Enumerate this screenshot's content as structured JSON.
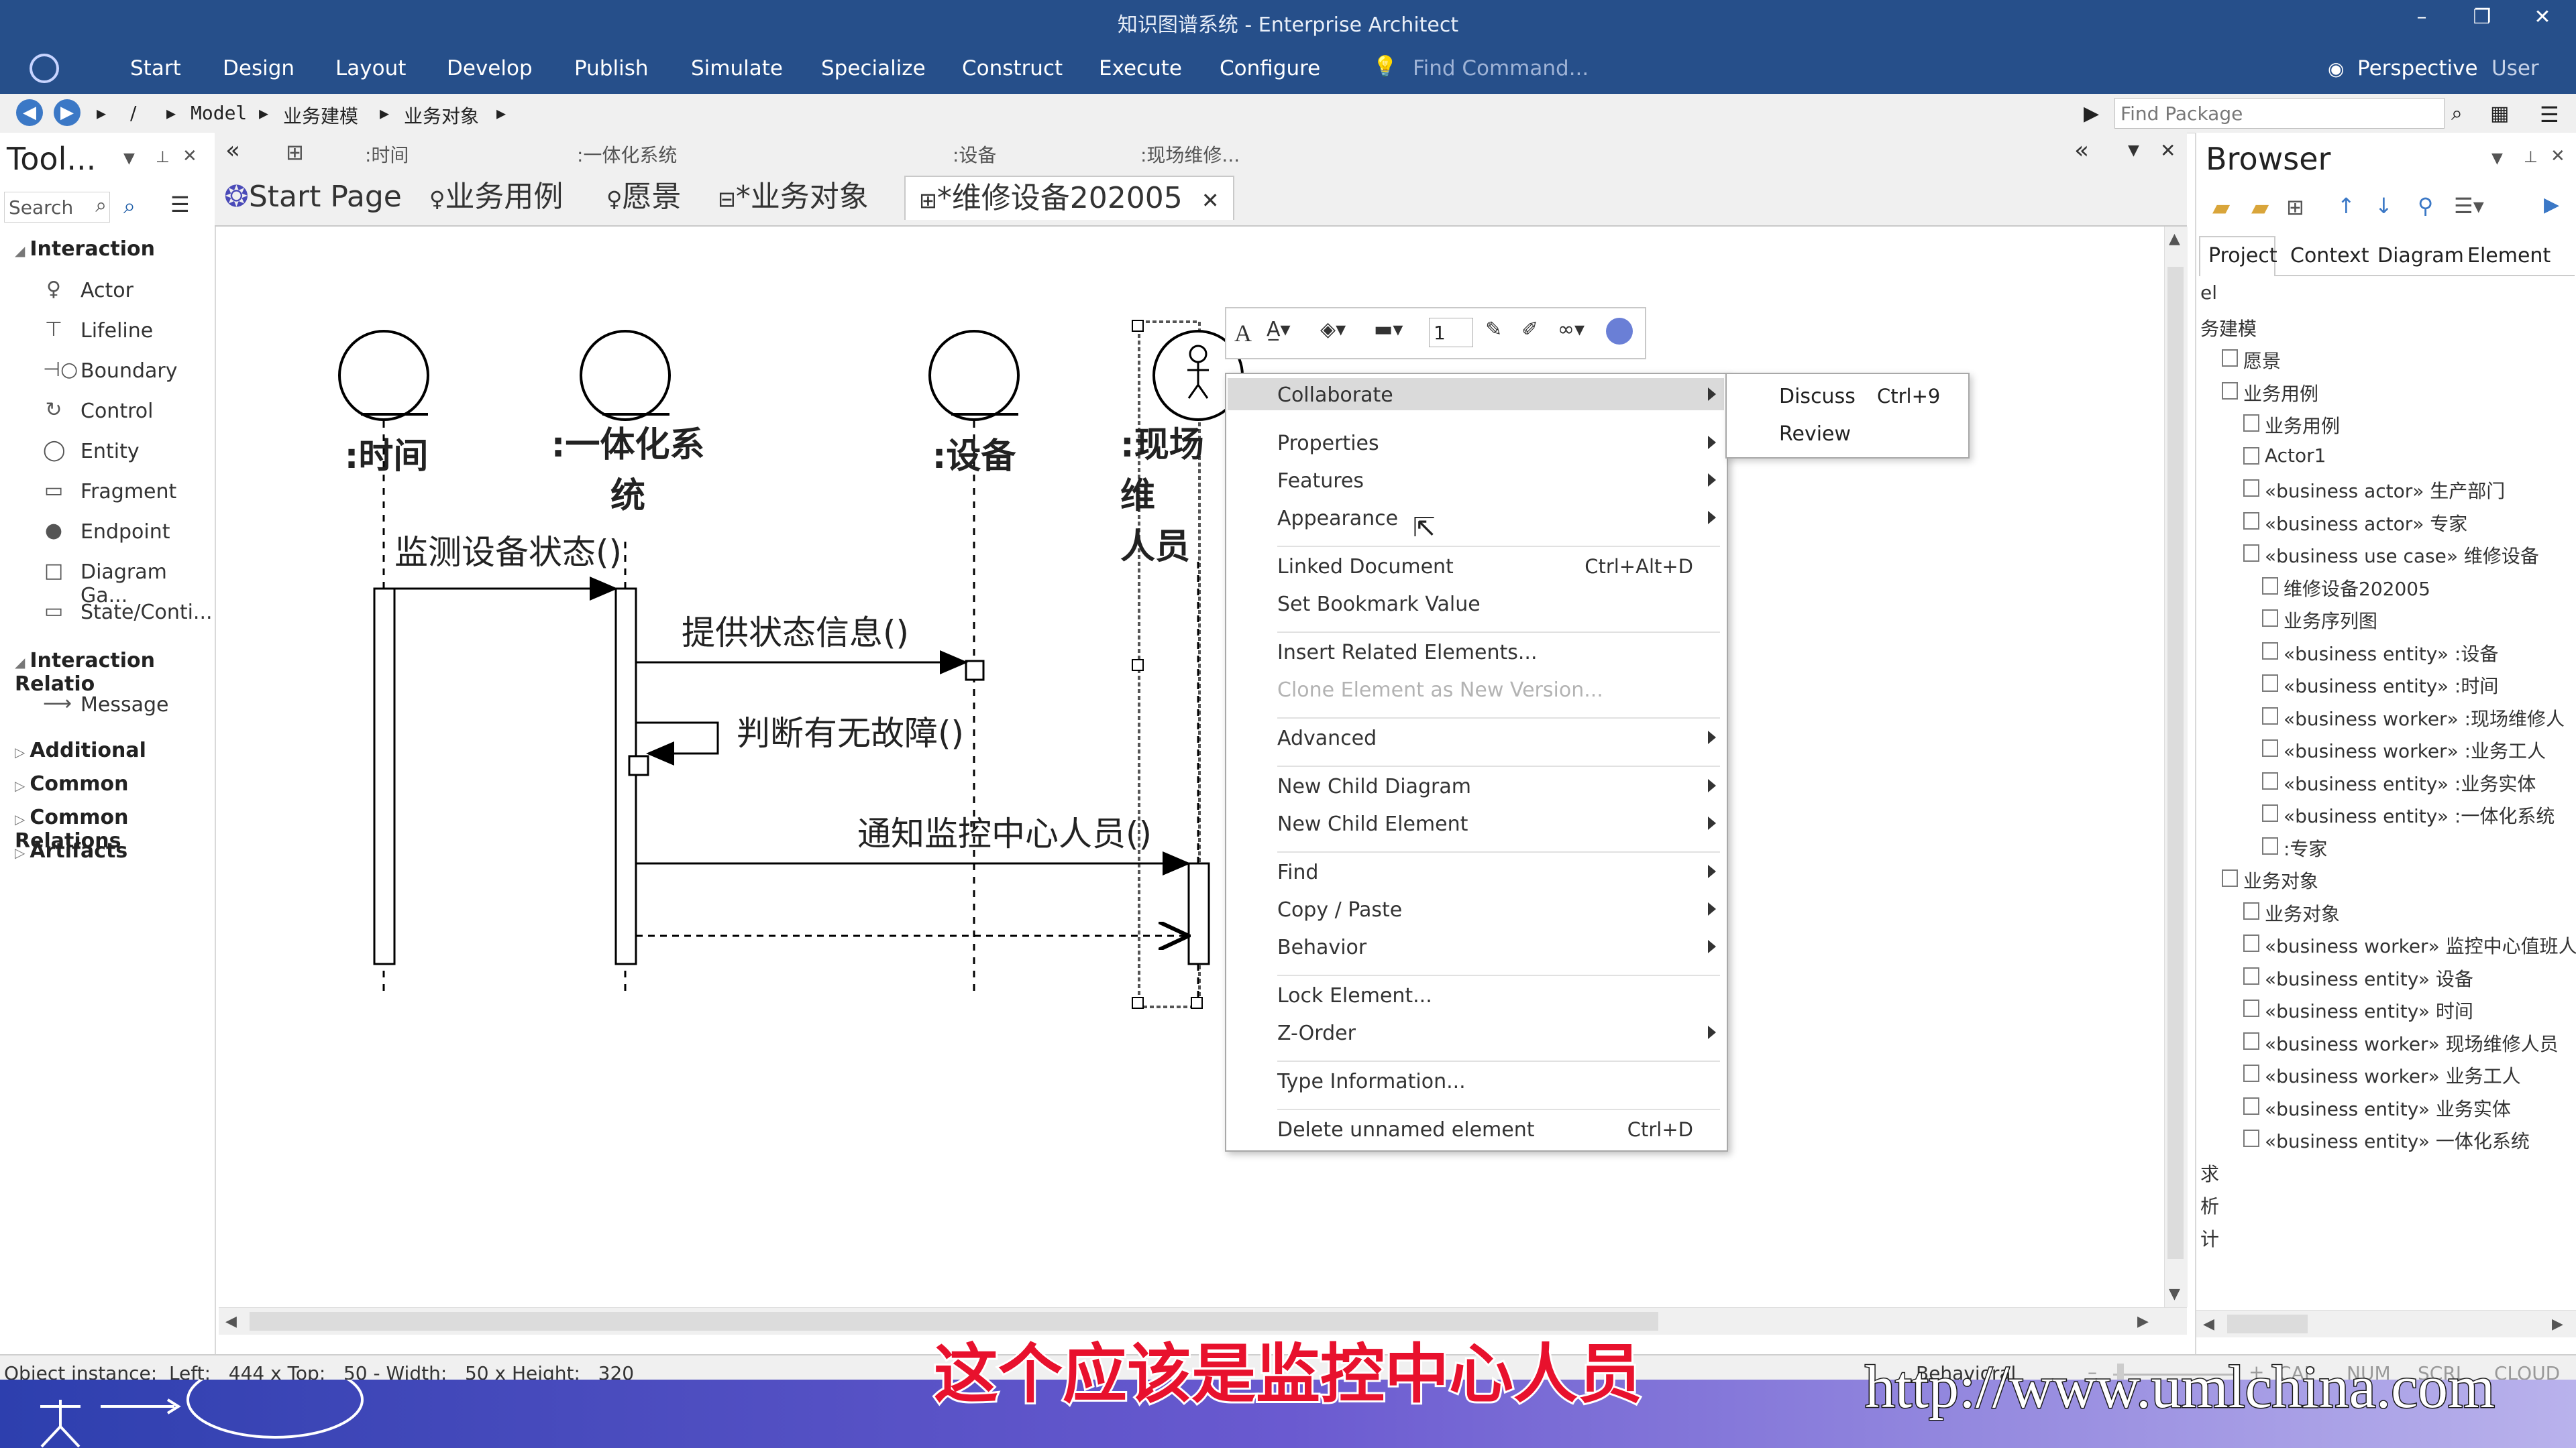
{
  "window": {
    "title": "知识图谱系统 - Enterprise Architect"
  },
  "menu": {
    "items": [
      "Start",
      "Design",
      "Layout",
      "Develop",
      "Publish",
      "Simulate",
      "Specialize",
      "Construct",
      "Execute",
      "Configure"
    ],
    "find_placeholder": "Find Command...",
    "perspective": "Perspective",
    "user": "User"
  },
  "nav": {
    "path": [
      "/",
      "Model",
      "业务建模",
      "业务对象"
    ],
    "find_package_placeholder": "Find Package"
  },
  "toolbox": {
    "title": "Tool...",
    "search_placeholder": "Search",
    "groups": [
      {
        "label": "Interaction",
        "items": [
          "Actor",
          "Lifeline",
          "Boundary",
          "Control",
          "Entity",
          "Fragment",
          "Endpoint",
          "Diagram Ga...",
          "State/Conti..."
        ]
      },
      {
        "label": "Interaction Relatio",
        "items": [
          "Message"
        ]
      },
      {
        "label": "Additional",
        "items": []
      },
      {
        "label": "Common",
        "items": []
      },
      {
        "label": "Common Relations",
        "items": []
      },
      {
        "label": "Artifacts",
        "items": []
      }
    ]
  },
  "docbar": {
    "labels": [
      ":时间",
      ":一体化系统",
      ":设备",
      ":现场维修..."
    ]
  },
  "tabs": [
    {
      "label": "Start Page"
    },
    {
      "label": "业务用例"
    },
    {
      "label": "愿景"
    },
    {
      "label": "*业务对象"
    },
    {
      "label": "*维修设备202005"
    }
  ],
  "diagram": {
    "lifelines": [
      ":时间",
      ":一体化系统",
      ":设备",
      ":现场维修人员"
    ],
    "lifeline_labels_shown": [
      ":时间",
      ":一体化系\n统",
      ":设备",
      ":现场维\n人员"
    ],
    "messages": [
      "监测设备状态()",
      "提供状态信息()",
      "判断有无故障()",
      "通知监控中心人员()"
    ]
  },
  "format_toolbar": {
    "line_width": "1"
  },
  "context_menu": {
    "items": [
      {
        "label": "Collaborate",
        "sub": true,
        "highlight": true
      },
      {
        "label": "Properties",
        "sub": true
      },
      {
        "label": "Features",
        "sub": true
      },
      {
        "label": "Appearance",
        "sub": true
      },
      {
        "label": "Linked Document",
        "shortcut": "Ctrl+Alt+D"
      },
      {
        "label": "Set Bookmark Value"
      },
      {
        "label": "Insert Related Elements..."
      },
      {
        "label": "Clone Element as New Version...",
        "disabled": true
      },
      {
        "label": "Advanced",
        "sub": true
      },
      {
        "label": "New Child Diagram",
        "sub": true
      },
      {
        "label": "New Child Element",
        "sub": true
      },
      {
        "label": "Find",
        "sub": true
      },
      {
        "label": "Copy / Paste",
        "sub": true
      },
      {
        "label": "Behavior",
        "sub": true
      },
      {
        "label": "Lock Element..."
      },
      {
        "label": "Z-Order",
        "sub": true
      },
      {
        "label": "Type Information..."
      },
      {
        "label": "Delete unnamed element",
        "shortcut": "Ctrl+D"
      }
    ],
    "submenu": [
      {
        "label": "Discuss",
        "shortcut": "Ctrl+9"
      },
      {
        "label": "Review"
      }
    ]
  },
  "browser": {
    "title": "Browser",
    "tabs": [
      "Project",
      "Context",
      "Diagram",
      "Element"
    ],
    "tree": [
      {
        "label": "el",
        "level": 0
      },
      {
        "label": "务建模",
        "level": 0
      },
      {
        "label": "愿景",
        "level": 1
      },
      {
        "label": "业务用例",
        "level": 1
      },
      {
        "label": "业务用例",
        "level": 2
      },
      {
        "label": "Actor1",
        "level": 2
      },
      {
        "label": "«business actor» 生产部门",
        "level": 2
      },
      {
        "label": "«business actor» 专家",
        "level": 2
      },
      {
        "label": "«business use case» 维修设备",
        "level": 2
      },
      {
        "label": "维修设备202005",
        "level": 3
      },
      {
        "label": "业务序列图",
        "level": 3
      },
      {
        "label": "«business entity» :设备",
        "level": 3
      },
      {
        "label": "«business entity» :时间",
        "level": 3
      },
      {
        "label": "«business worker» :现场维修人",
        "level": 3
      },
      {
        "label": "«business worker» :业务工人",
        "level": 3
      },
      {
        "label": "«business entity» :业务实体",
        "level": 3
      },
      {
        "label": "«business entity» :一体化系统",
        "level": 3
      },
      {
        "label": ":专家",
        "level": 3
      },
      {
        "label": "业务对象",
        "level": 1
      },
      {
        "label": "业务对象",
        "level": 2
      },
      {
        "label": "«business worker» 监控中心值班人",
        "level": 2
      },
      {
        "label": "«business entity» 设备",
        "level": 2
      },
      {
        "label": "«business entity» 时间",
        "level": 2
      },
      {
        "label": "«business worker» 现场维修人员",
        "level": 2
      },
      {
        "label": "«business worker» 业务工人",
        "level": 2
      },
      {
        "label": "«business entity» 业务实体",
        "level": 2
      },
      {
        "label": "«business entity» 一体化系统",
        "level": 2
      },
      {
        "label": "求",
        "level": 0
      },
      {
        "label": "析",
        "level": 0
      },
      {
        "label": "计",
        "level": 0
      }
    ]
  },
  "status": {
    "object_info": "Object instance:  Left:   444 x Top:   50 - Width:   50 x Height:   320",
    "mode": "Behavioral",
    "indicators": [
      "CAP",
      "NUM",
      "SCRL",
      "CLOUD"
    ]
  },
  "overlay": {
    "subtitle": "这个应该是监控中心人员",
    "watermark": "http://www.umlchina.com"
  }
}
